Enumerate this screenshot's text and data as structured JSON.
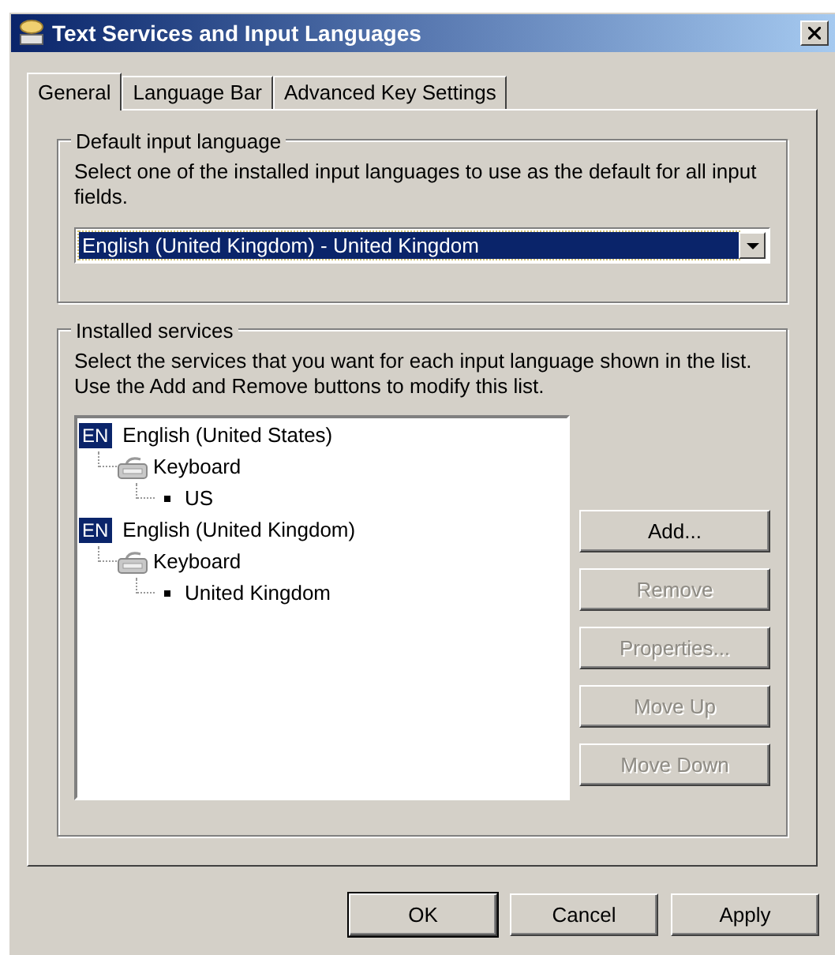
{
  "window": {
    "title": "Text Services and Input Languages"
  },
  "tabs": [
    {
      "label": "General",
      "selected": true
    },
    {
      "label": "Language Bar",
      "selected": false
    },
    {
      "label": "Advanced Key Settings",
      "selected": false
    }
  ],
  "default_input_language": {
    "title": "Default input language",
    "description": "Select one of the installed input languages to use as the default for all input fields.",
    "value": "English (United Kingdom) - United Kingdom"
  },
  "installed_services": {
    "title": "Installed services",
    "description": "Select the services that you want for each input language shown in the list. Use the Add and Remove buttons to modify this list.",
    "tree": [
      {
        "badge": "EN",
        "label": "English (United States)",
        "children": [
          {
            "label": "Keyboard",
            "children": [
              {
                "label": "US"
              }
            ]
          }
        ]
      },
      {
        "badge": "EN",
        "label": "English (United Kingdom)",
        "children": [
          {
            "label": "Keyboard",
            "children": [
              {
                "label": "United Kingdom"
              }
            ]
          }
        ]
      }
    ],
    "buttons": [
      {
        "label": "Add...",
        "disabled": false
      },
      {
        "label": "Remove",
        "disabled": true
      },
      {
        "label": "Properties...",
        "disabled": true
      },
      {
        "label": "Move Up",
        "disabled": true
      },
      {
        "label": "Move Down",
        "disabled": true
      }
    ]
  },
  "dialog_buttons": [
    {
      "label": "OK",
      "default": true
    },
    {
      "label": "Cancel",
      "default": false
    },
    {
      "label": "Apply",
      "default": false
    }
  ]
}
